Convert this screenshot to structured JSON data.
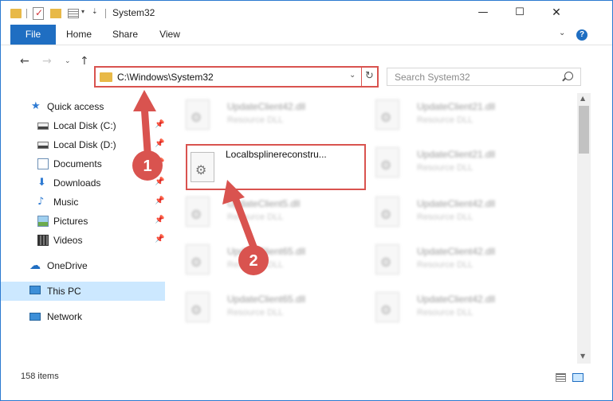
{
  "window": {
    "title": "System32",
    "controls": {
      "minimize": "—",
      "maximize": "☐",
      "close": "✕"
    }
  },
  "quick_access_toolbar": {
    "icons": [
      "folder-icon",
      "properties-icon",
      "new-folder-icon",
      "view-icon",
      "dropdown-icon"
    ]
  },
  "ribbon": {
    "tabs": [
      {
        "label": "File",
        "active": true
      },
      {
        "label": "Home"
      },
      {
        "label": "Share"
      },
      {
        "label": "View"
      }
    ],
    "help_label": "?"
  },
  "navigation": {
    "back": "←",
    "forward": "→",
    "recent": "⌄",
    "up": "↑"
  },
  "address_bar": {
    "path": "C:\\Windows\\System32",
    "dropdown": "⌄",
    "refresh": "↻"
  },
  "search": {
    "placeholder": "Search System32"
  },
  "nav_pane": {
    "items": [
      {
        "label": "Quick access",
        "icon": "star-icon"
      },
      {
        "label": "Local Disk (C:)",
        "icon": "drive-icon",
        "pinned": true
      },
      {
        "label": "Local Disk (D:)",
        "icon": "drive-icon",
        "pinned": true
      },
      {
        "label": "Documents",
        "icon": "documents-icon",
        "pinned": true
      },
      {
        "label": "Downloads",
        "icon": "downloads-icon",
        "pinned": true
      },
      {
        "label": "Music",
        "icon": "music-icon",
        "pinned": true
      },
      {
        "label": "Pictures",
        "icon": "pictures-icon",
        "pinned": true
      },
      {
        "label": "Videos",
        "icon": "videos-icon",
        "pinned": true
      },
      {
        "label": "OneDrive",
        "icon": "cloud-icon"
      },
      {
        "label": "This PC",
        "icon": "pc-icon",
        "selected": true
      },
      {
        "label": "Network",
        "icon": "network-icon"
      }
    ],
    "pin_glyph": "📌"
  },
  "files": {
    "left_column": [
      {
        "name": "UpdateClient42.dll",
        "type": "Resource DLL"
      },
      {
        "name": "UpdateClient5.dll",
        "type": "Resource DLL"
      },
      {
        "name": "UpdateClient65.dll",
        "type": "Resource DLL"
      },
      {
        "name": "UpdateClient65.dll",
        "type": "Resource DLL"
      }
    ],
    "right_column": [
      {
        "name": "UpdateClient21.dll",
        "type": "Resource DLL"
      },
      {
        "name": "UpdateClient21.dll",
        "type": "Resource DLL"
      },
      {
        "name": "UpdateClient42.dll",
        "type": "Resource DLL"
      },
      {
        "name": "UpdateClient42.dll",
        "type": "Resource DLL"
      },
      {
        "name": "UpdateClient42.dll",
        "type": "Resource DLL"
      }
    ],
    "highlighted": {
      "name": "Localbsplinereconstru..."
    }
  },
  "status_bar": {
    "item_count": "158 items"
  },
  "annotations": {
    "step1": "1",
    "step2": "2",
    "color": "#d9534f"
  }
}
